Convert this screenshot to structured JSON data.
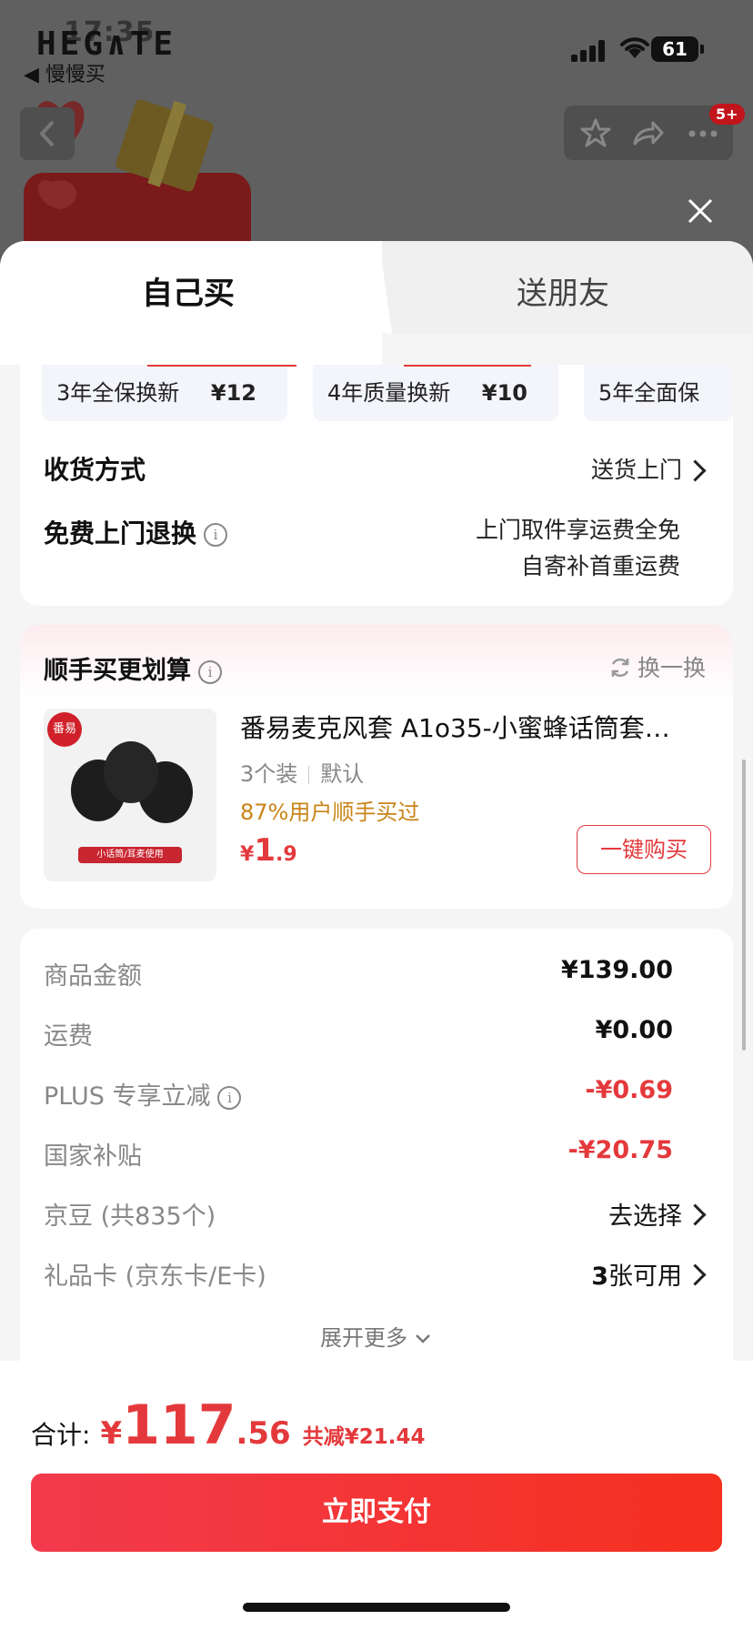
{
  "status": {
    "time": "17:35",
    "logo": "HEG∧TE",
    "back_app": "◀ 慢慢买",
    "battery": "61"
  },
  "background": {
    "badge": "5+"
  },
  "tabs": {
    "self": "自己买",
    "friend": "送朋友"
  },
  "services": [
    {
      "name": "3年全保换新",
      "price": "¥12"
    },
    {
      "name": "4年质量换新",
      "price": "¥10"
    },
    {
      "name": "5年全面保"
    }
  ],
  "delivery": {
    "label": "收货方式",
    "value": "送货上门"
  },
  "free_return": {
    "label": "免费上门退换",
    "info": "i",
    "line1": "上门取件享运费全免",
    "line2": "自寄补首重运费"
  },
  "recommend": {
    "title": "顺手买更划算",
    "info": "i",
    "swap": "换一换",
    "product": {
      "brand": "番易",
      "image_tag": "小话筒/耳麦使用",
      "name": "番易麦克风套 A1o35-小蜜蜂话筒套…",
      "spec": "3个装",
      "variant": "默认",
      "rate": "87%用户顺手买过",
      "currency": "¥",
      "price_int": "1",
      "price_dec": ".9",
      "buy": "一键购买"
    }
  },
  "fees": [
    {
      "label": "商品金额",
      "value": "¥139.00"
    },
    {
      "label": "运费",
      "value": "¥0.00"
    },
    {
      "label": "PLUS 专享立减",
      "value": "-¥0.69"
    },
    {
      "label": "国家补贴",
      "value": "-¥20.75"
    },
    {
      "label": "京豆 (共835个)",
      "value": "去选择"
    },
    {
      "label": "礼品卡 (京东卡/E卡)",
      "value_num": "3",
      "value": "张可用"
    }
  ],
  "expand": "展开更多",
  "total": {
    "label": "合计:",
    "currency": "¥",
    "int": "117",
    "dec": ".56",
    "saving": "共减¥21.44"
  },
  "pay": "立即支付",
  "colors": {
    "accent": "#e4393c",
    "pay_start": "#f23a4d",
    "pay_end": "#f5301f",
    "rate": "#c98417"
  }
}
